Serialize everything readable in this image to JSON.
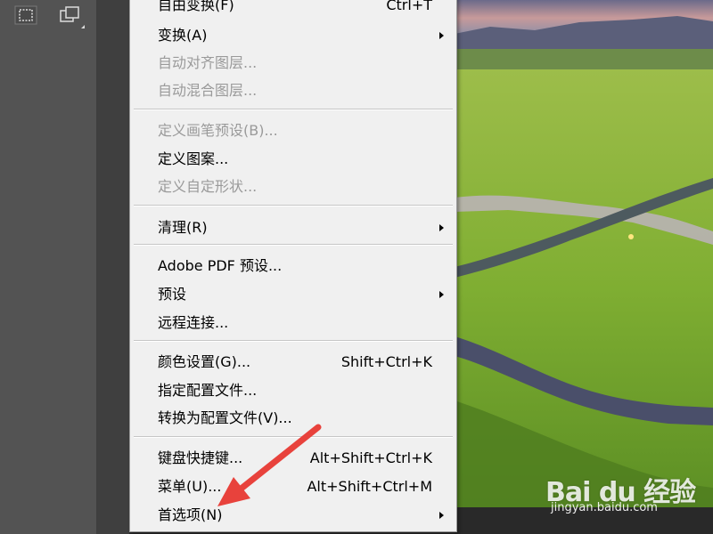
{
  "menu": {
    "items": [
      {
        "label": "自由变换(F)",
        "shortcut": "Ctrl+T",
        "disabled": false,
        "submenu": false
      },
      {
        "label": "变换(A)",
        "shortcut": "",
        "disabled": false,
        "submenu": true
      },
      {
        "label": "自动对齐图层...",
        "shortcut": "",
        "disabled": true,
        "submenu": false
      },
      {
        "label": "自动混合图层...",
        "shortcut": "",
        "disabled": true,
        "submenu": false
      },
      {
        "label": "定义画笔预设(B)...",
        "shortcut": "",
        "disabled": true,
        "submenu": false
      },
      {
        "label": "定义图案...",
        "shortcut": "",
        "disabled": false,
        "submenu": false
      },
      {
        "label": "定义自定形状...",
        "shortcut": "",
        "disabled": true,
        "submenu": false
      },
      {
        "label": "清理(R)",
        "shortcut": "",
        "disabled": false,
        "submenu": true
      },
      {
        "label": "Adobe PDF 预设...",
        "shortcut": "",
        "disabled": false,
        "submenu": false
      },
      {
        "label": "预设",
        "shortcut": "",
        "disabled": false,
        "submenu": true
      },
      {
        "label": "远程连接...",
        "shortcut": "",
        "disabled": false,
        "submenu": false
      },
      {
        "label": "颜色设置(G)...",
        "shortcut": "Shift+Ctrl+K",
        "disabled": false,
        "submenu": false
      },
      {
        "label": "指定配置文件...",
        "shortcut": "",
        "disabled": false,
        "submenu": false
      },
      {
        "label": "转换为配置文件(V)...",
        "shortcut": "",
        "disabled": false,
        "submenu": false
      },
      {
        "label": "键盘快捷键...",
        "shortcut": "Alt+Shift+Ctrl+K",
        "disabled": false,
        "submenu": false
      },
      {
        "label": "菜单(U)...",
        "shortcut": "Alt+Shift+Ctrl+M",
        "disabled": false,
        "submenu": false
      },
      {
        "label": "首选项(N)",
        "shortcut": "",
        "disabled": false,
        "submenu": true
      }
    ]
  },
  "toolbar": {
    "icons": [
      "rectangular-marquee-icon",
      "layers-icon"
    ]
  },
  "watermark": {
    "logo": "Bai du 经验",
    "url": "jingyan.baidu.com"
  },
  "colors": {
    "menu_bg": "#f0f0f0",
    "disabled_text": "#9a9a9a",
    "annotation_arrow": "#e8423c",
    "panel_bg": "#535353"
  }
}
